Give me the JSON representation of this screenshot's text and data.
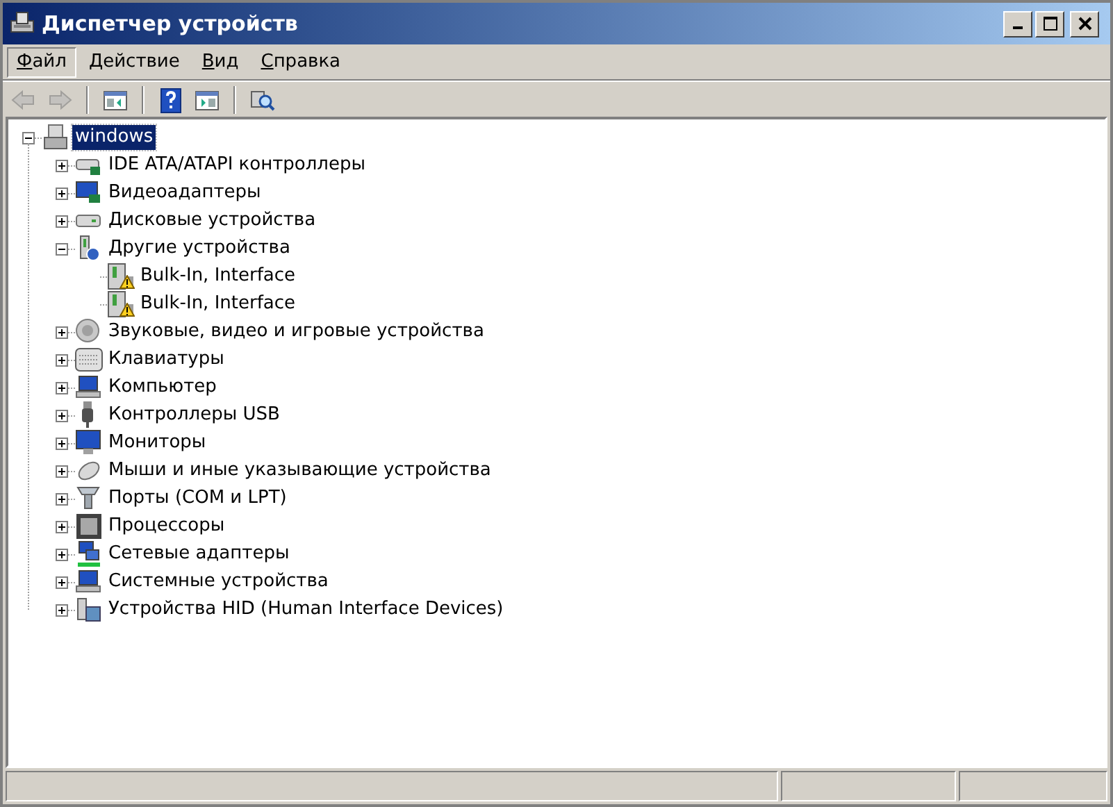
{
  "window": {
    "title": "Диспетчер устройств"
  },
  "menu": [
    {
      "label": "Файл",
      "selected": true
    },
    {
      "label": "Действие",
      "selected": false
    },
    {
      "label": "Вид",
      "selected": false
    },
    {
      "label": "Справка",
      "selected": false
    }
  ],
  "toolbar": [
    {
      "kind": "back",
      "disabled": true
    },
    {
      "kind": "forward",
      "disabled": true
    },
    {
      "kind": "separator"
    },
    {
      "kind": "pane",
      "disabled": false
    },
    {
      "kind": "separator"
    },
    {
      "kind": "help",
      "disabled": false
    },
    {
      "kind": "properties",
      "disabled": false
    },
    {
      "kind": "separator"
    },
    {
      "kind": "scan",
      "disabled": false
    }
  ],
  "tree": {
    "label": "windows",
    "selected": true,
    "expanded": true,
    "children": [
      {
        "label": "IDE ATA/ATAPI контроллеры",
        "expanded": false
      },
      {
        "label": "Видеоадаптеры",
        "expanded": false
      },
      {
        "label": "Дисковые устройства",
        "expanded": false
      },
      {
        "label": "Другие устройства",
        "expanded": true,
        "children": [
          {
            "label": "Bulk-In, Interface",
            "warning": true
          },
          {
            "label": "Bulk-In, Interface",
            "warning": true
          }
        ]
      },
      {
        "label": "Звуковые, видео и игровые устройства",
        "expanded": false
      },
      {
        "label": "Клавиатуры",
        "expanded": false
      },
      {
        "label": "Компьютер",
        "expanded": false
      },
      {
        "label": "Контроллеры USB",
        "expanded": false
      },
      {
        "label": "Мониторы",
        "expanded": false
      },
      {
        "label": "Мыши и иные указывающие устройства",
        "expanded": false
      },
      {
        "label": "Порты (COM и LPT)",
        "expanded": false
      },
      {
        "label": "Процессоры",
        "expanded": false
      },
      {
        "label": "Сетевые адаптеры",
        "expanded": false
      },
      {
        "label": "Системные устройства",
        "expanded": false
      },
      {
        "label": "Устройства HID (Human Interface Devices)",
        "expanded": false
      }
    ]
  }
}
